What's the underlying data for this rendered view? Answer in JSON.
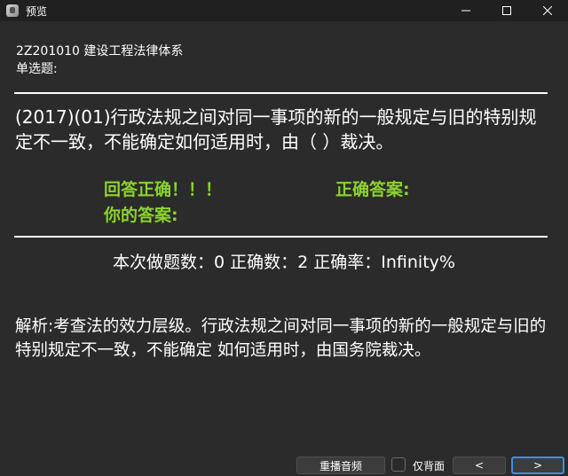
{
  "window": {
    "title": "预览",
    "controls": [
      "minimize-icon",
      "maximize-icon",
      "close-icon"
    ]
  },
  "header": {
    "subject": "2Z201010 建设工程法律体系",
    "question_type": "单选题:"
  },
  "question": {
    "text": "(2017)(01)行政法规之间对同一事项的新的一般规定与旧的特别规定不一致，不能确定如何适用时，由（ ）裁决。"
  },
  "result": {
    "status": "回答正确！！！",
    "correct_answer_label": "正确答案:",
    "your_answer_label": "你的答案:"
  },
  "stats": {
    "text": "本次做题数：0 正确数：2 正确率：Infinity%"
  },
  "analysis": {
    "text": "解析:考查法的效力层级。行政法规之间对同一事项的新的一般规定与旧的特别规定不一致，不能确定 如何适用时，由国务院裁决。"
  },
  "controls": {
    "replay_audio": "重播音频",
    "back_only": "仅背面",
    "prev": "<",
    "next": ">"
  },
  "colors": {
    "background": "#2b2b2b",
    "titlebar": "#202020",
    "accent_green": "#8ad42a",
    "focus_blue": "#3d8ee0"
  }
}
